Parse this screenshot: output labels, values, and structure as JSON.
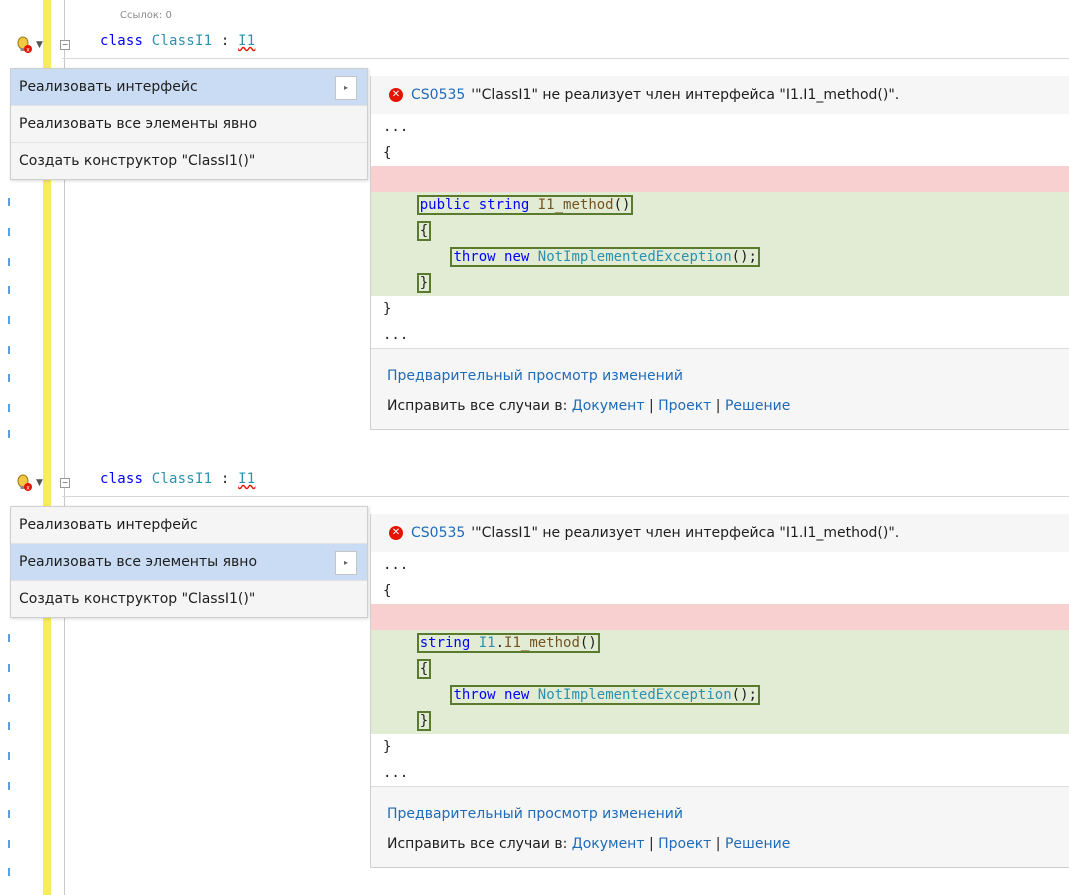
{
  "refs_label": "Ссылок: 0",
  "code_line": {
    "kw": "class",
    "class_name": "ClassI1",
    "colon": ":",
    "iface": "I1"
  },
  "menu": {
    "items": [
      {
        "label": "Реализовать интерфейс"
      },
      {
        "label": "Реализовать все элементы явно"
      },
      {
        "label": "Создать конструктор \"ClassI1()\""
      }
    ]
  },
  "arrow_glyph": "▸",
  "panel1": {
    "error_code": "CS0535",
    "error_message": "'\"ClassI1\" не реализует член интерфейса \"I1.I1_method()\".",
    "dots": "...",
    "open_brace": "{",
    "close_brace": "}",
    "sig_kw1": "public",
    "sig_kw2": "string",
    "sig_name": "I1_method",
    "sig_parens": "()",
    "inner_open": "{",
    "inner_close": "}",
    "throw_kw": "throw",
    "new_kw": "new",
    "exception_type": "NotImplementedException",
    "throw_tail": "();",
    "preview_link": "Предварительный просмотр изменений",
    "fix_all_prefix": "Исправить все случаи в:",
    "scope_document": "Документ",
    "scope_project": "Проект",
    "scope_solution": "Решение",
    "pipe": "|"
  },
  "panel2": {
    "error_code": "CS0535",
    "error_message": "'\"ClassI1\" не реализует член интерфейса \"I1.I1_method()\".",
    "dots": "...",
    "open_brace": "{",
    "close_brace": "}",
    "sig_kw2": "string",
    "sig_iface": "I1",
    "sig_dot": ".",
    "sig_name": "I1_method",
    "sig_parens": "()",
    "inner_open": "{",
    "inner_close": "}",
    "throw_kw": "throw",
    "new_kw": "new",
    "exception_type": "NotImplementedException",
    "throw_tail": "();",
    "preview_link": "Предварительный просмотр изменений",
    "fix_all_prefix": "Исправить все случаи в:",
    "scope_document": "Документ",
    "scope_project": "Проект",
    "scope_solution": "Решение",
    "pipe": "|"
  },
  "colors": {
    "accent_link": "#1e6bb8",
    "selected_menu": "#c9dcf3",
    "removed_line": "#f9d0d0",
    "added_block": "#e2ecd5",
    "error_icon": "#e51400"
  }
}
